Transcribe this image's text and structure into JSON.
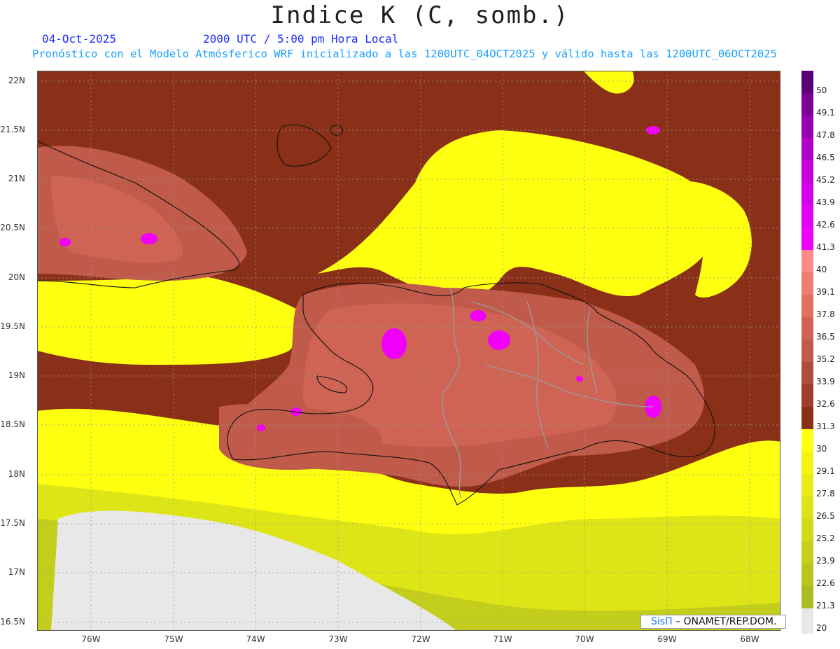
{
  "header": {
    "title": "Indice K (C, somb.)",
    "date": "04-Oct-2025",
    "time": "2000 UTC / 5:00 pm Hora Local",
    "subtitle": "Pronóstico con el Modelo Atmósferico WRF inicializado a las 1200UTC_04OCT2025 y válido hasta las  1200UTC_06OCT2025"
  },
  "axes": {
    "lat_labels": [
      "22N",
      "21.5N",
      "21N",
      "20.5N",
      "20N",
      "19.5N",
      "19N",
      "18.5N",
      "18N",
      "17.5N",
      "17N",
      "16.5N"
    ],
    "lon_labels": [
      "76W",
      "75W",
      "74W",
      "73W",
      "72W",
      "71W",
      "70W",
      "69W",
      "68W"
    ]
  },
  "legend": {
    "labels": [
      "50",
      "49.1",
      "47.8",
      "46.5",
      "45.2",
      "43.9",
      "42.6",
      "41.3",
      "40",
      "39.1",
      "37.8",
      "36.5",
      "35.2",
      "33.9",
      "32.6",
      "31.3",
      "30",
      "29.1",
      "27.8",
      "26.5",
      "25.2",
      "23.9",
      "22.6",
      "21.3",
      "20"
    ],
    "colors": {
      "c50": "#5c0075",
      "c49": "#7a0096",
      "c48": "#9600b0",
      "c47": "#b000c8",
      "c46": "#c400dc",
      "c45": "#d400ea",
      "c44": "#e400f4",
      "c43": "#f000fa",
      "c40": "#ff8a8a",
      "c39": "#f07e70",
      "c38": "#e07060",
      "c37": "#d06454",
      "c35": "#c05a4a",
      "c34": "#b04c3c",
      "c33": "#9e3e2c",
      "c31": "#8a3018",
      "c30": "#ffff10",
      "c29": "#f4f412",
      "c28": "#e8ec14",
      "c27": "#dce418",
      "c25": "#d0da1a",
      "c24": "#c4d01c",
      "c22": "#b8c61e",
      "c21": "#acbc20",
      "c20": "#e8e8e8"
    }
  },
  "credit": {
    "brand": "SisΠ",
    "agency": "– ONAMET/REP.DOM."
  }
}
